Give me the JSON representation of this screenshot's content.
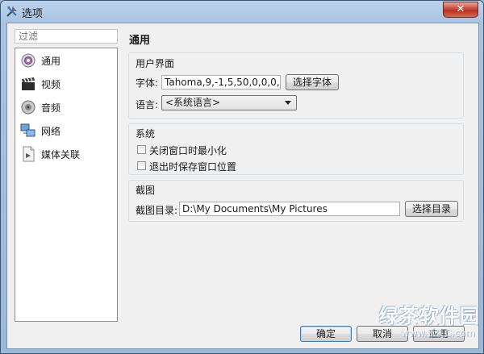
{
  "window": {
    "title": "选项",
    "close_glyph": "✕"
  },
  "sidebar": {
    "filter_placeholder": "过滤",
    "items": [
      {
        "label": "通用",
        "icon": "gear-icon"
      },
      {
        "label": "视频",
        "icon": "clapperboard-icon"
      },
      {
        "label": "音频",
        "icon": "speaker-icon"
      },
      {
        "label": "网络",
        "icon": "network-icon"
      },
      {
        "label": "媒体关联",
        "icon": "media-file-icon"
      }
    ]
  },
  "main": {
    "page_title": "通用",
    "ui_group": {
      "title": "用户界面",
      "font_label": "字体:",
      "font_value": "Tahoma,9,-1,5,50,0,0,0,0,0",
      "choose_font_button": "选择字体",
      "language_label": "语言:",
      "language_value": "<系统语言>"
    },
    "system_group": {
      "title": "系统",
      "minimize_on_close": "关闭窗口时最小化",
      "save_window_pos": "退出时保存窗口位置"
    },
    "screenshot_group": {
      "title": "截图",
      "dir_label": "截图目录:",
      "dir_value": "D:\\My Documents\\My Pictures",
      "choose_dir_button": "选择目录"
    }
  },
  "footer": {
    "ok": "确定",
    "cancel": "取消",
    "apply": "应用"
  },
  "watermark": {
    "name": "绿茶软件园",
    "url": "www.33LC.com"
  }
}
